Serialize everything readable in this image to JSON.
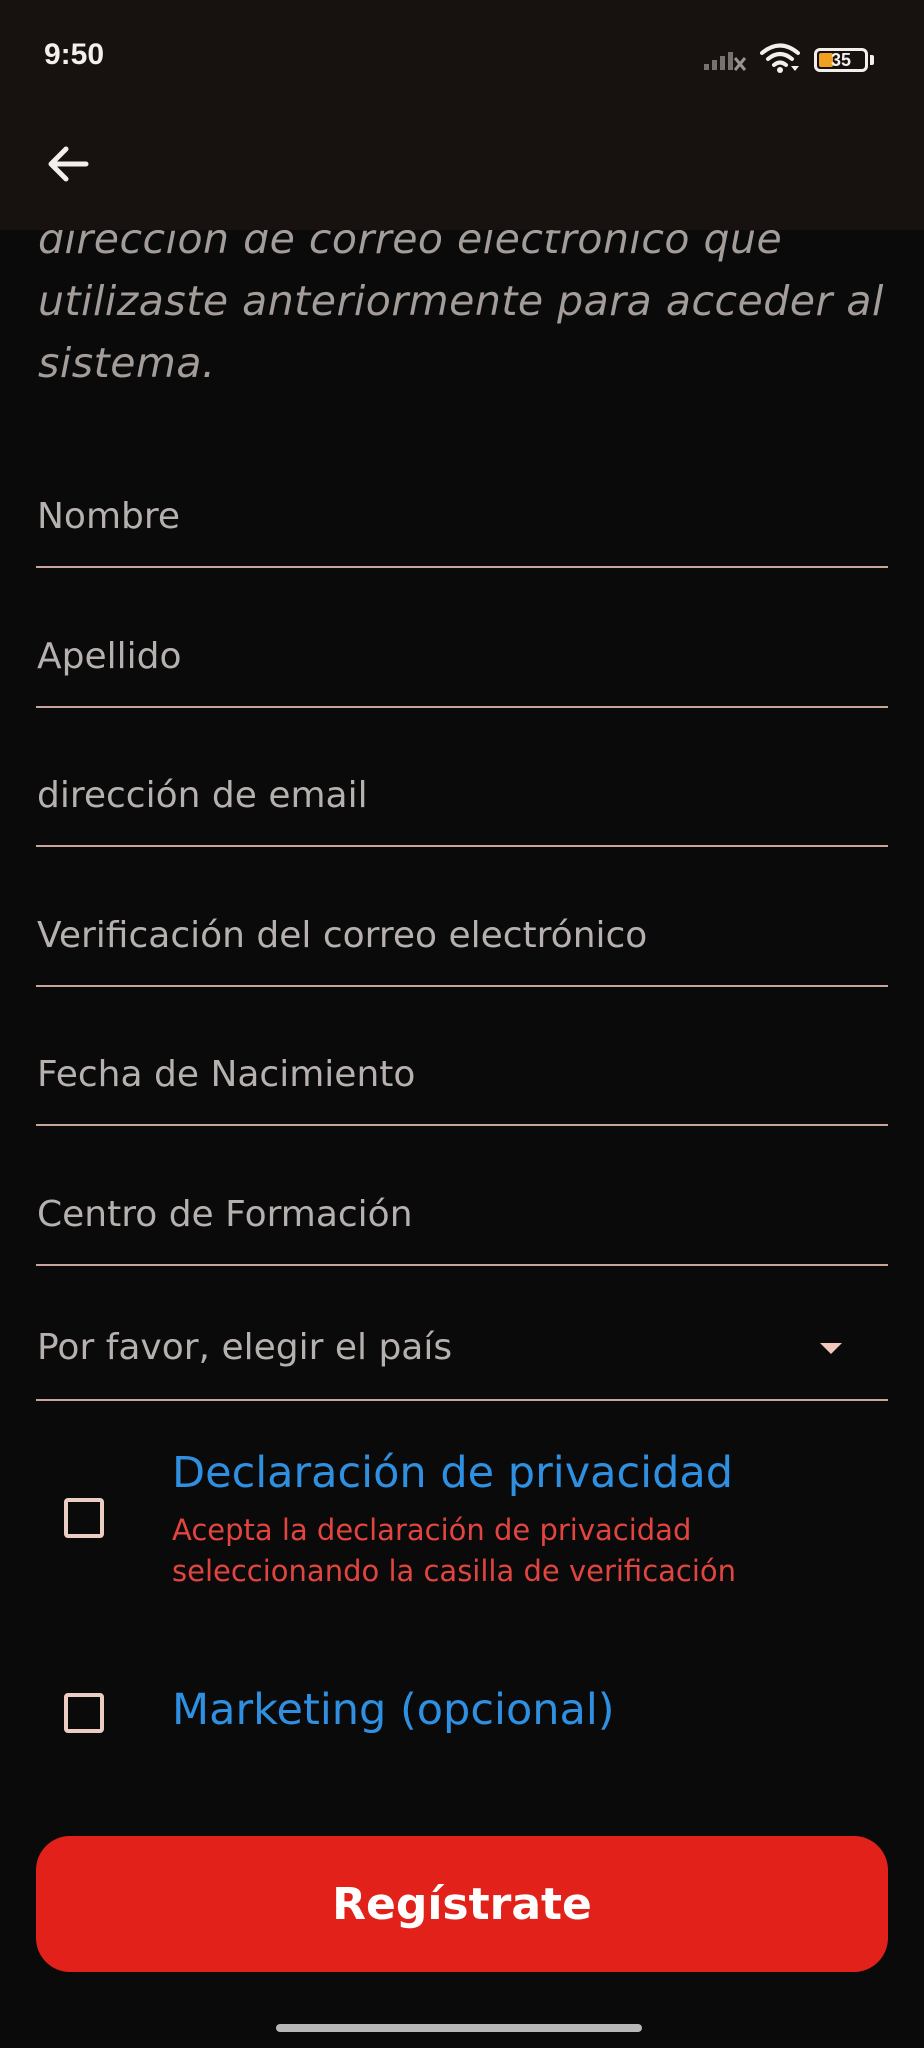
{
  "status_bar": {
    "time": "9:50",
    "battery": "35",
    "colors": {
      "battery_fill": "#f0a020",
      "icons": "#f2efed"
    },
    "icons": [
      "signal-icon",
      "wifi-icon",
      "battery-icon"
    ]
  },
  "toolbar": {
    "back_icon": "arrow-left-icon",
    "background": "#17120f"
  },
  "intro_text": "dirección de correo electrónico que utilizaste anteriormente para acceder al sistema.",
  "form": {
    "fields": [
      {
        "label": "Nombre"
      },
      {
        "label": "Apellido"
      },
      {
        "label": "dirección de email"
      },
      {
        "label": "Verificación del correo electrónico"
      },
      {
        "label": "Fecha de Nacimiento"
      },
      {
        "label": "Centro de Formación"
      },
      {
        "label": "Por favor, elegir el país",
        "type": "dropdown"
      }
    ],
    "underline_color": "#c9a49a"
  },
  "checkboxes": {
    "privacy": {
      "title": "Declaración de privacidad",
      "error": "Acepta la declaración de privacidad seleccionando la casilla de verificación",
      "checked": false
    },
    "marketing": {
      "title": "Marketing (opcional)",
      "checked": false
    },
    "colors": {
      "title": "#2f8fe0",
      "error": "#e2443f"
    }
  },
  "submit": {
    "label": "Regístrate",
    "color": "#e2211a"
  }
}
